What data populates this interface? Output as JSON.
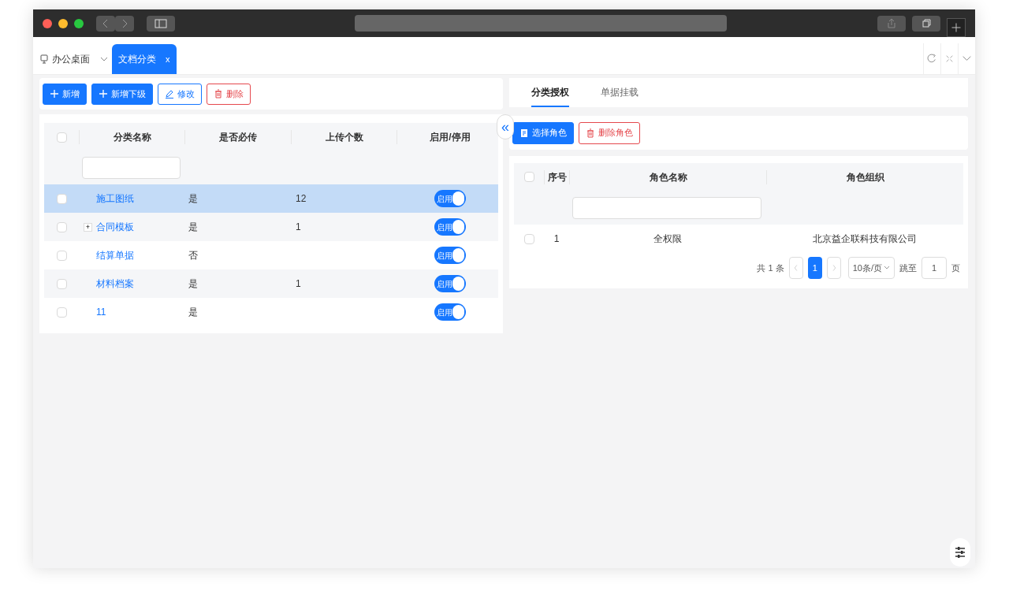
{
  "page_tabs": [
    {
      "label": "办公桌面",
      "kind": "home",
      "selected": false
    },
    {
      "label": "文档分类",
      "kind": "closable",
      "close": "x",
      "selected": true
    }
  ],
  "toolbar": [
    {
      "label": "新增",
      "kind": "primary"
    },
    {
      "label": "新增下级",
      "kind": "primary"
    },
    {
      "label": "修改",
      "kind": "outline"
    },
    {
      "label": "删除",
      "kind": "danger"
    }
  ],
  "category_table": {
    "header_checked": false,
    "columns": [
      "分类名称",
      "是否必传",
      "上传个数",
      "启用/停用"
    ],
    "rows": [
      {
        "name": "施工图纸",
        "required": "是",
        "count": "12",
        "switch_label": "启用",
        "enabled": true,
        "expandable": false,
        "selected": true,
        "checked": false
      },
      {
        "name": "合同模板",
        "required": "是",
        "count": "1",
        "switch_label": "启用",
        "enabled": true,
        "expandable": true,
        "expander": "+",
        "selected": false,
        "checked": false
      },
      {
        "name": "结算单据",
        "required": "否",
        "count": "",
        "switch_label": "启用",
        "enabled": true,
        "expandable": false,
        "selected": false,
        "checked": false
      },
      {
        "name": "材料档案",
        "required": "是",
        "count": "1",
        "switch_label": "启用",
        "enabled": true,
        "expandable": false,
        "selected": false,
        "checked": false
      },
      {
        "name": "11",
        "required": "是",
        "count": "",
        "switch_label": "启用",
        "enabled": true,
        "expandable": false,
        "selected": false,
        "checked": false
      }
    ]
  },
  "collapse_toggle": "«",
  "detail_tabs": [
    {
      "label": "分类授权",
      "selected": true
    },
    {
      "label": "单据挂载",
      "selected": false
    }
  ],
  "role_toolbar": [
    {
      "label": "选择角色",
      "kind": "primary"
    },
    {
      "label": "删除角色",
      "kind": "danger"
    }
  ],
  "role_table": {
    "header_checked": false,
    "columns": [
      "序号",
      "角色名称",
      "角色组织"
    ],
    "rows": [
      {
        "index": "1",
        "name": "全权限",
        "org": "北京益企联科技有限公司",
        "checked": false
      }
    ]
  },
  "pagination": {
    "total": "共 1 条",
    "pages": [
      {
        "label": "1",
        "selected": true
      }
    ],
    "page_size": "10条/页",
    "jump_label": "跳至",
    "jump_value": "1",
    "page_unit": "页"
  }
}
